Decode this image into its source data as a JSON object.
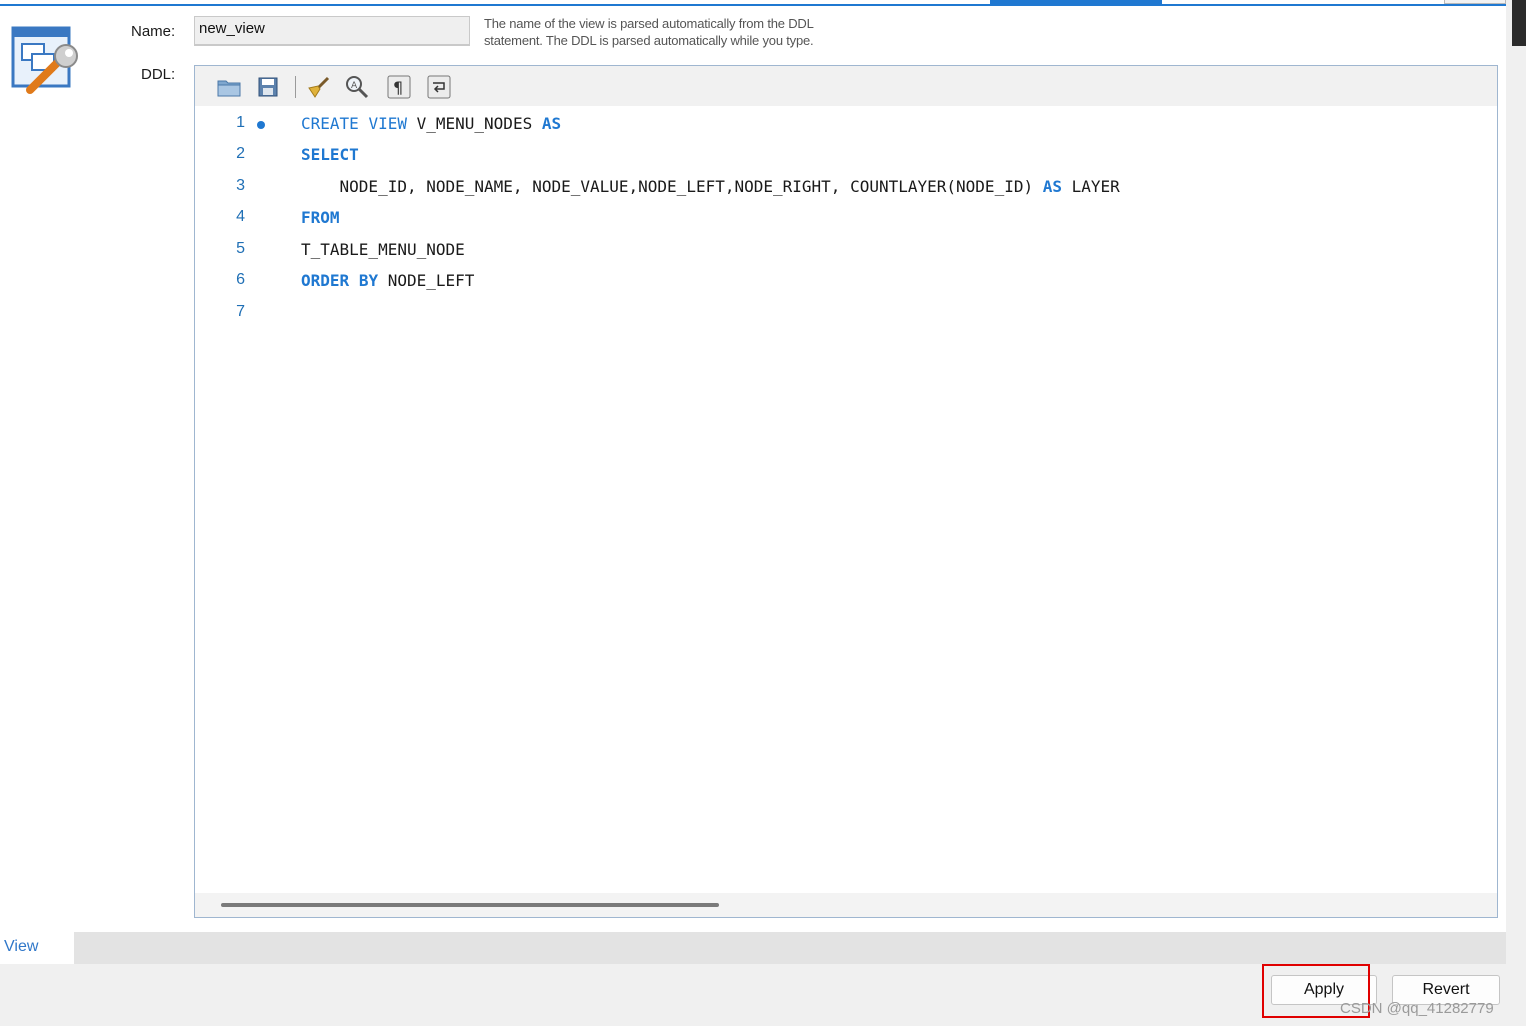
{
  "form": {
    "name_label": "Name:",
    "name_value": "new_view",
    "ddl_label": "DDL:",
    "hint_line1": "The name of the view is parsed automatically from the DDL",
    "hint_line2": "statement. The DDL is parsed automatically while you type."
  },
  "toolbar": {
    "icons": [
      "open-folder-icon",
      "save-icon",
      "beautify-broom-icon",
      "find-icon",
      "show-invisibles-icon",
      "word-wrap-icon"
    ]
  },
  "code": {
    "line_numbers": [
      "1",
      "2",
      "3",
      "4",
      "5",
      "6",
      "7"
    ],
    "l1_kw1": "CREATE",
    "l1_kw2": "VIEW",
    "l1_name": "V_MENU_NODES",
    "l1_kw3": "AS",
    "l2_kw": "SELECT",
    "l3_cols": "    NODE_ID, NODE_NAME, NODE_VALUE,NODE_LEFT,NODE_RIGHT, COUNTLAYER(NODE_ID)",
    "l3_kw": "AS",
    "l3_alias": "LAYER",
    "l4_kw": "FROM",
    "l5_table": "T_TABLE_MENU_NODE",
    "l6_kw1": "ORDER",
    "l6_kw2": "BY",
    "l6_col": "NODE_LEFT"
  },
  "tabs": {
    "view": "View"
  },
  "buttons": {
    "apply": "Apply",
    "revert": "Revert"
  },
  "watermark": "CSDN @qq_41282779",
  "colors": {
    "accent": "#1f78d1",
    "keyword": "#1f78d1",
    "highlight": "#e00000"
  }
}
